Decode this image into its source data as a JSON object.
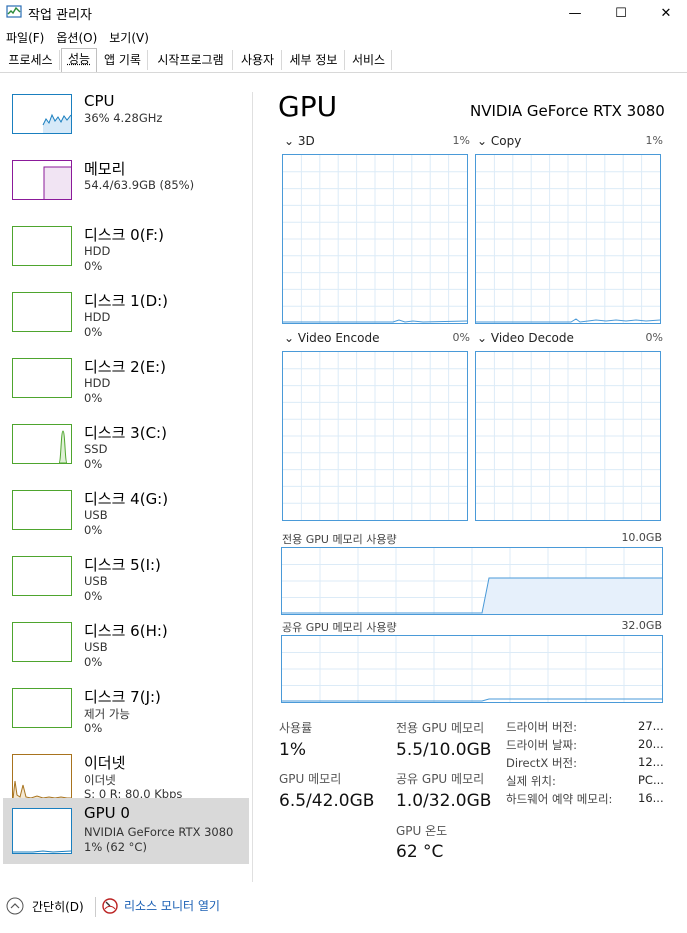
{
  "window": {
    "title": "작업 관리자",
    "minimize": "—",
    "maximize": "☐",
    "close": "✕"
  },
  "menu": [
    "파일(F)",
    "옵션(O)",
    "보기(V)"
  ],
  "tabs": [
    "프로세스",
    "성능",
    "앱 기록",
    "시작프로그램",
    "사용자",
    "세부 정보",
    "서비스"
  ],
  "active_tab": "성능",
  "sidebar": [
    {
      "title": "CPU",
      "sub1": "36% 4.28GHz",
      "sub2": "",
      "color": "#1a7fbf"
    },
    {
      "title": "메모리",
      "sub1": "54.4/63.9GB (85%)",
      "sub2": "",
      "color": "#8b1a9a"
    },
    {
      "title": "디스크 0(F:)",
      "sub1": "HDD",
      "sub2": "0%",
      "color": "#4ea52e"
    },
    {
      "title": "디스크 1(D:)",
      "sub1": "HDD",
      "sub2": "0%",
      "color": "#4ea52e"
    },
    {
      "title": "디스크 2(E:)",
      "sub1": "HDD",
      "sub2": "0%",
      "color": "#4ea52e"
    },
    {
      "title": "디스크 3(C:)",
      "sub1": "SSD",
      "sub2": "0%",
      "color": "#4ea52e"
    },
    {
      "title": "디스크 4(G:)",
      "sub1": "USB",
      "sub2": "0%",
      "color": "#4ea52e"
    },
    {
      "title": "디스크 5(I:)",
      "sub1": "USB",
      "sub2": "0%",
      "color": "#4ea52e"
    },
    {
      "title": "디스크 6(H:)",
      "sub1": "USB",
      "sub2": "0%",
      "color": "#4ea52e"
    },
    {
      "title": "디스크 7(J:)",
      "sub1": "제거 가능",
      "sub2": "0%",
      "color": "#4ea52e"
    },
    {
      "title": "이더넷",
      "sub1": "이더넷",
      "sub2": "S: 0 R: 80.0 Kbps",
      "color": "#a8731e"
    },
    {
      "title": "GPU 0",
      "sub1": "NVIDIA GeForce RTX 3080",
      "sub2": "1% (62 °C)",
      "color": "#1a7fbf"
    }
  ],
  "main": {
    "title": "GPU",
    "model": "NVIDIA GeForce RTX 3080",
    "engines": [
      {
        "label": "3D",
        "pct": "1%"
      },
      {
        "label": "Copy",
        "pct": "1%"
      },
      {
        "label": "Video Encode",
        "pct": "0%"
      },
      {
        "label": "Video Decode",
        "pct": "0%"
      }
    ],
    "dedicated": {
      "label": "전용 GPU 메모리 사용량",
      "max": "10.0GB"
    },
    "shared": {
      "label": "공유 GPU 메모리 사용량",
      "max": "32.0GB"
    },
    "stats": {
      "usage_label": "사용률",
      "usage_value": "1%",
      "gpu_mem_label": "GPU 메모리",
      "gpu_mem_value": "6.5/42.0GB",
      "ded_label": "전용 GPU 메모리",
      "ded_value": "5.5/10.0GB",
      "shared_label": "공유 GPU 메모리",
      "shared_value": "1.0/32.0GB",
      "temp_label": "GPU 온도",
      "temp_value": "62 °C"
    },
    "info": [
      {
        "label": "드라이버 버전:",
        "value": "27..."
      },
      {
        "label": "드라이버 날짜:",
        "value": "20..."
      },
      {
        "label": "DirectX 버전:",
        "value": "12..."
      },
      {
        "label": "실제 위치:",
        "value": "PC..."
      },
      {
        "label": "하드웨어 예약 메모리:",
        "value": "16..."
      }
    ]
  },
  "footer": {
    "collapse_label": "간단히(D)",
    "monitor_label": "리소스 모니터 열기"
  }
}
